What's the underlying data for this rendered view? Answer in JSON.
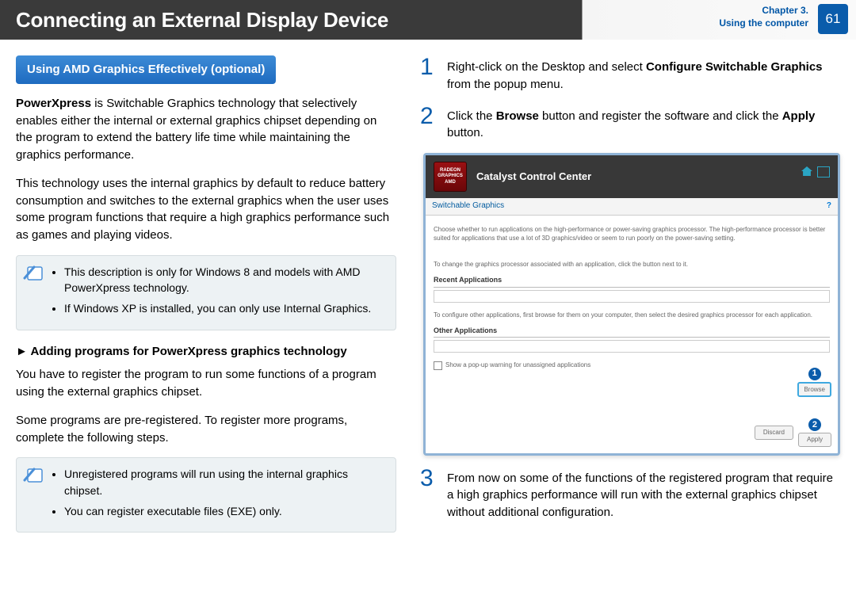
{
  "header": {
    "title": "Connecting an External Display Device",
    "chapter_line1": "Chapter 3.",
    "chapter_line2": "Using the computer",
    "page_number": "61"
  },
  "left": {
    "section_heading": "Using AMD Graphics Effectively (optional)",
    "para1_bold": "PowerXpress",
    "para1_rest": " is Switchable Graphics technology that selectively enables either the internal or external graphics chipset depending on the program to extend the battery life time while maintaining the graphics performance.",
    "para2": "This technology uses the internal graphics by default to reduce battery consumption and switches to the external graphics when the user uses some program functions that require a high graphics performance such as games and playing videos.",
    "note1_item1": "This description is only for Windows 8 and models with AMD PowerXpress technology.",
    "note1_item2": "If Windows XP is installed, you can only use Internal Graphics.",
    "subheading": "► Adding programs for PowerXpress graphics technology",
    "para3": "You have to register the program to run some functions of a program using the external graphics chipset.",
    "para4": "Some programs are pre-registered. To register more programs, complete the following steps.",
    "note2_item1": "Unregistered programs will run using the internal graphics chipset.",
    "note2_item2": "You can register executable files (EXE) only."
  },
  "right": {
    "step1_a": "Right-click on the Desktop and select ",
    "step1_bold": "Configure Switchable Graphics",
    "step1_b": " from the popup menu.",
    "step2_a": "Click the ",
    "step2_bold1": "Browse",
    "step2_b": " button and register the software and click the ",
    "step2_bold2": "Apply",
    "step2_c": " button.",
    "step3": "From now on some of the functions of the registered program that require a high graphics performance will run with the external graphics chipset without additional configuration."
  },
  "screenshot": {
    "logo_line1": "RADEON",
    "logo_line2": "GRAPHICS",
    "logo_line3": "AMD",
    "window_title": "Catalyst Control Center",
    "tab": "Switchable Graphics",
    "help": "?",
    "desc1": "Choose whether to run applications on the high-performance or power-saving graphics processor. The high-performance processor is better suited for applications that use a lot of 3D graphics/video or seem to run poorly on the power-saving setting.",
    "desc2": "To change the graphics processor associated with an application, click the button next to it.",
    "recent_label": "Recent Applications",
    "desc3": "To configure other applications, first browse for them on your computer, then select the desired graphics processor for each application.",
    "other_label": "Other Applications",
    "checkbox": "Show a pop-up warning for unassigned applications",
    "callout1": "1",
    "browse_btn": "Browse",
    "callout2": "2",
    "discard_btn": "Discard",
    "apply_btn": "Apply"
  }
}
